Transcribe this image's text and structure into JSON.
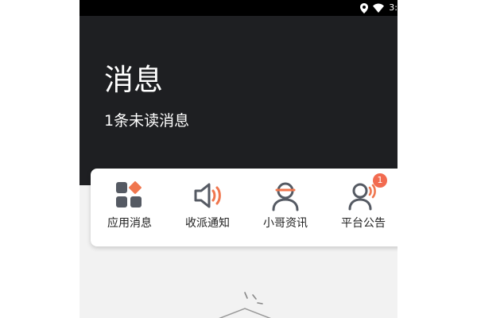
{
  "status_bar": {
    "time": "3:",
    "icons": [
      "location-icon",
      "wifi-icon"
    ]
  },
  "header": {
    "title": "消息",
    "subtitle": "1条未读消息"
  },
  "tabs": [
    {
      "label": "应用消息",
      "icon": "apps-grid-icon"
    },
    {
      "label": "收派通知",
      "icon": "speaker-icon"
    },
    {
      "label": "小哥资讯",
      "icon": "courier-icon"
    },
    {
      "label": "平台公告",
      "icon": "announcement-icon",
      "badge": "1"
    }
  ],
  "colors": {
    "header_bg": "#1e1f22",
    "icon_dark": "#555a63",
    "icon_accent": "#f0764e",
    "badge": "#f26b50",
    "page_bg": "#f2f2f2"
  }
}
